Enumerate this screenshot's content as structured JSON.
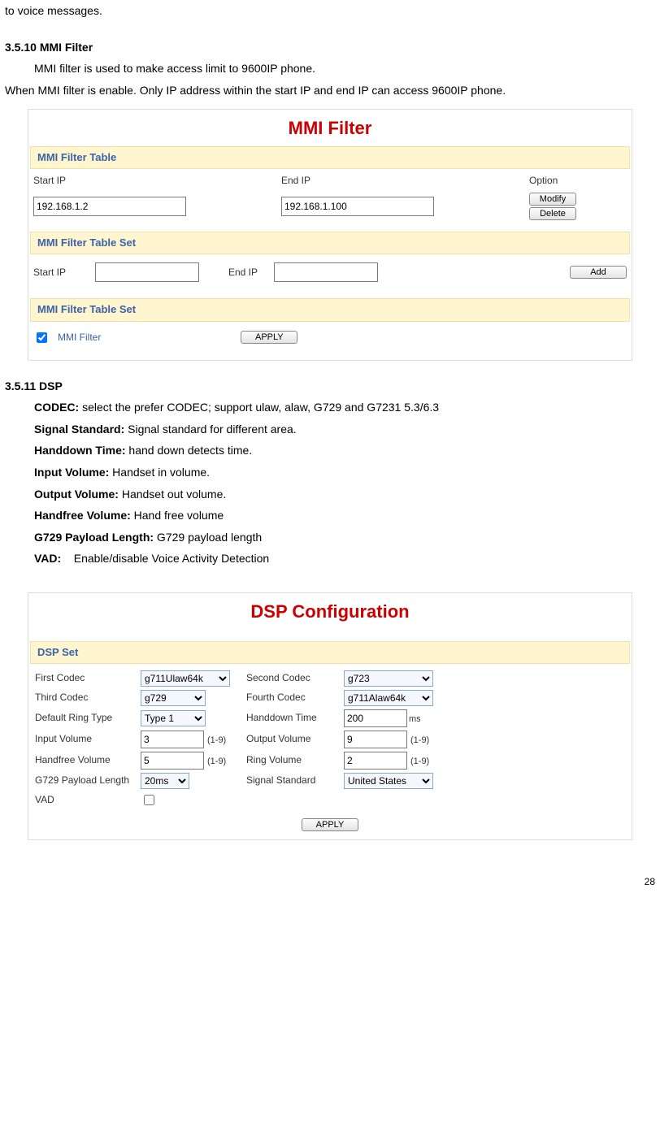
{
  "intro_top": "to voice messages.",
  "sec_mmi": {
    "title": "3.5.10 MMI Filter",
    "p1": "MMI filter is used to make access limit to 9600IP phone.",
    "p2": "When MMI filter is enable. Only IP address within the start IP and end IP can access 9600IP phone."
  },
  "mmi_panel": {
    "title": "MMI Filter",
    "bar1": "MMI Filter Table",
    "hdr_start": "Start IP",
    "hdr_end": "End IP",
    "hdr_option": "Option",
    "val_start": "192.168.1.2",
    "val_end": "192.168.1.100",
    "btn_modify": "Modify",
    "btn_delete": "Delete",
    "bar2": "MMI Filter Table Set",
    "lbl_start2": "Start IP",
    "lbl_end2": "End IP",
    "btn_add": "Add",
    "bar3": "MMI Filter Table Set",
    "chk_label": "MMI Filter",
    "btn_apply": "APPLY"
  },
  "sec_dsp": {
    "title": "3.5.11 DSP",
    "items": {
      "codec_l": "CODEC:",
      "codec_t": " select the prefer CODEC; support ulaw, alaw, G729 and G7231 5.3/6.3",
      "sig_l": "Signal Standard:",
      "sig_t": " Signal standard for different area.",
      "hand_l": "Handdown Time:",
      "hand_t": " hand down detects time.",
      "inv_l": "Input Volume:",
      "inv_t": " Handset in volume.",
      "outv_l": "Output Volume:",
      "outv_t": " Handset out volume.",
      "hf_l": "Handfree Volume:",
      "hf_t": " Hand free volume",
      "g729_l": "G729 Payload Length:",
      "g729_t": " G729 payload length",
      "vad_l": "VAD:",
      "vad_t": "    Enable/disable Voice Activity Detection"
    }
  },
  "dsp_panel": {
    "title": "DSP Configuration",
    "bar": "DSP Set",
    "first_codec_l": "First Codec",
    "first_codec_v": "g711Ulaw64k",
    "second_codec_l": "Second Codec",
    "second_codec_v": "g723",
    "third_codec_l": "Third Codec",
    "third_codec_v": "g729",
    "fourth_codec_l": "Fourth Codec",
    "fourth_codec_v": "g711Alaw64k",
    "ring_type_l": "Default Ring Type",
    "ring_type_v": "Type 1",
    "handdown_l": "Handdown Time",
    "handdown_v": "200",
    "handdown_suffix": "ms",
    "input_vol_l": "Input Volume",
    "input_vol_v": "3",
    "range_hint": "(1-9)",
    "output_vol_l": "Output Volume",
    "output_vol_v": "9",
    "handfree_vol_l": "Handfree Volume",
    "handfree_vol_v": "5",
    "ring_vol_l": "Ring Volume",
    "ring_vol_v": "2",
    "g729_len_l": "G729 Payload Length",
    "g729_len_v": "20ms",
    "signal_std_l": "Signal Standard",
    "signal_std_v": "United States",
    "vad_l": "VAD",
    "btn_apply": "APPLY"
  },
  "page_number": "28"
}
